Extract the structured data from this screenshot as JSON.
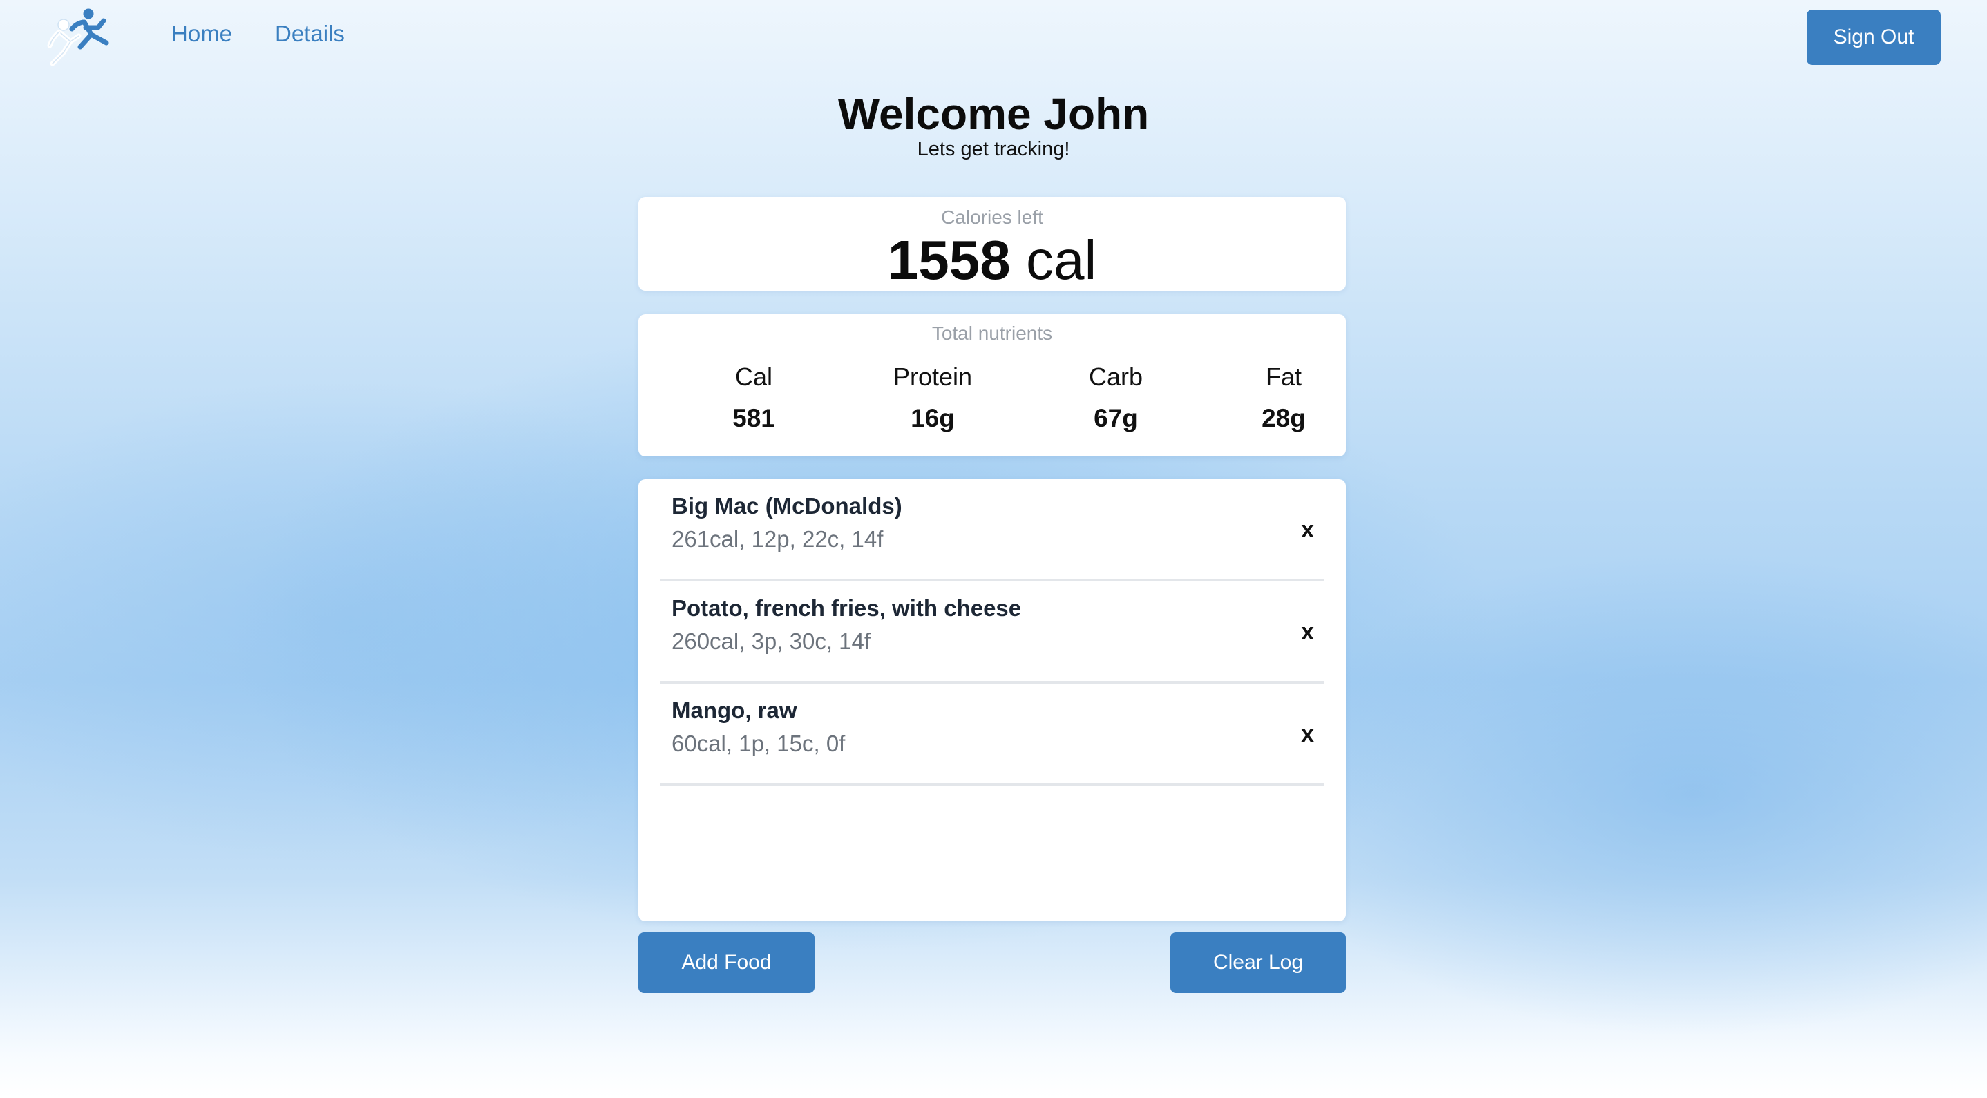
{
  "nav": {
    "home_label": "Home",
    "details_label": "Details",
    "signout_label": "Sign Out"
  },
  "header": {
    "welcome": "Welcome John",
    "subtitle": "Lets get tracking!"
  },
  "calories_left": {
    "label": "Calories left",
    "value": "1558",
    "unit": "cal"
  },
  "nutrients": {
    "label": "Total nutrients",
    "items": [
      {
        "name": "Cal",
        "value": "581"
      },
      {
        "name": "Protein",
        "value": "16g"
      },
      {
        "name": "Carb",
        "value": "67g"
      },
      {
        "name": "Fat",
        "value": "28g"
      }
    ]
  },
  "log": {
    "items": [
      {
        "name": "Big Mac (McDonalds)",
        "macros": "261cal, 12p, 22c, 14f",
        "remove": "x"
      },
      {
        "name": "Potato, french fries, with cheese",
        "macros": "260cal, 3p, 30c, 14f",
        "remove": "x"
      },
      {
        "name": "Mango, raw",
        "macros": "60cal, 1p, 15c, 0f",
        "remove": "x"
      }
    ]
  },
  "actions": {
    "add_label": "Add Food",
    "clear_label": "Clear Log"
  },
  "colors": {
    "accent": "#3a7fc1",
    "link": "#3a7fc0",
    "muted_text": "#9aa0a8"
  },
  "icons": {
    "logo": "running-figures-logo"
  }
}
